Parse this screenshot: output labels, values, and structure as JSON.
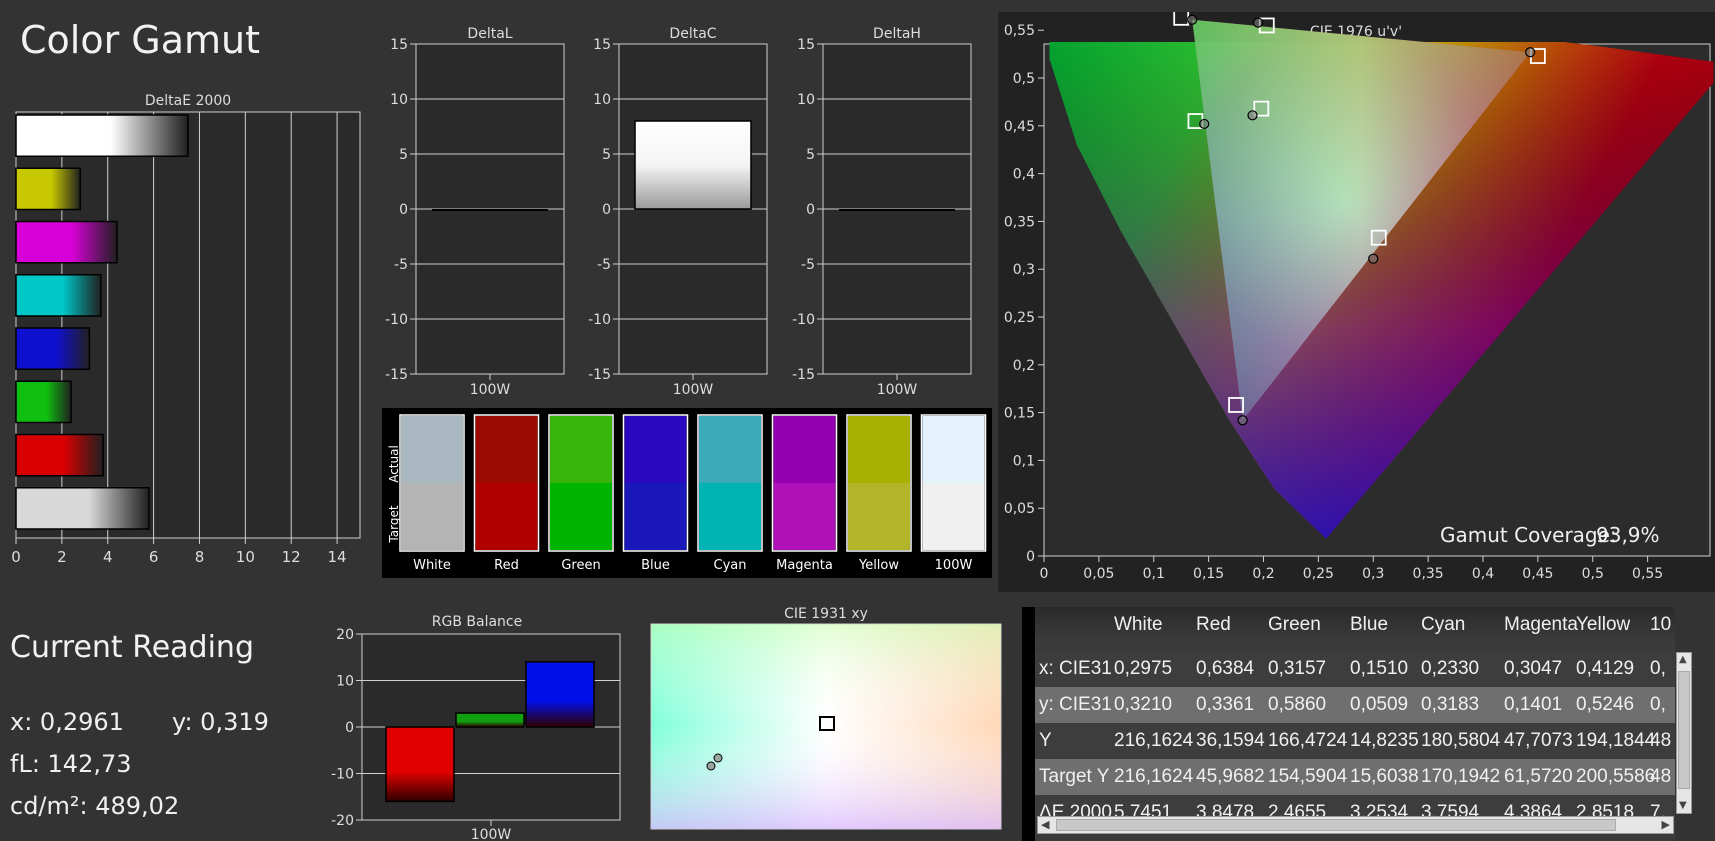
{
  "page": {
    "title": "Color Gamut"
  },
  "deltae": {
    "title": "DeltaE 2000",
    "x_ticks": [
      "0",
      "2",
      "4",
      "6",
      "8",
      "10",
      "12",
      "14"
    ],
    "bars": [
      {
        "value": 7.5,
        "color": "#ffffff"
      },
      {
        "value": 2.8,
        "color": "#c8c800"
      },
      {
        "value": 4.4,
        "color": "#d800d8"
      },
      {
        "value": 3.7,
        "color": "#00c8c8"
      },
      {
        "value": 3.2,
        "color": "#1010d0"
      },
      {
        "value": 2.4,
        "color": "#10c010"
      },
      {
        "value": 3.8,
        "color": "#d80000"
      },
      {
        "value": 5.8,
        "color": "#d8d8d8"
      }
    ]
  },
  "delta_panels": [
    {
      "title": "DeltaL",
      "value": 0,
      "xlabel": "100W"
    },
    {
      "title": "DeltaC",
      "value": 8,
      "xlabel": "100W"
    },
    {
      "title": "DeltaH",
      "value": 0,
      "xlabel": "100W"
    }
  ],
  "delta_y_ticks": [
    "15",
    "10",
    "5",
    "0",
    "-5",
    "-10",
    "-15"
  ],
  "swatches": {
    "actual_label": "Actual",
    "target_label": "Target",
    "items": [
      {
        "label": "White",
        "actual": "#a9b8c0",
        "target": "#b4b4b4"
      },
      {
        "label": "Red",
        "actual": "#9a0a00",
        "target": "#b00000"
      },
      {
        "label": "Green",
        "actual": "#38b40a",
        "target": "#00b400"
      },
      {
        "label": "Blue",
        "actual": "#2a08c0",
        "target": "#1a18b8"
      },
      {
        "label": "Cyan",
        "actual": "#3aaab8",
        "target": "#00b4b4"
      },
      {
        "label": "Magenta",
        "actual": "#9400b0",
        "target": "#b010b8"
      },
      {
        "label": "Yellow",
        "actual": "#a8b000",
        "target": "#b4b428"
      },
      {
        "label": "100W",
        "actual": "#e4f2fc",
        "target": "#f0f0f0"
      }
    ]
  },
  "cie1976": {
    "title": "CIE 1976 u'v'",
    "x_ticks": [
      "0",
      "0,05",
      "0,1",
      "0,15",
      "0,2",
      "0,25",
      "0,3",
      "0,35",
      "0,4",
      "0,45",
      "0,5",
      "0,55"
    ],
    "y_ticks": [
      "0",
      "0,05",
      "0,1",
      "0,15",
      "0,2",
      "0,25",
      "0,3",
      "0,35",
      "0,4",
      "0,45",
      "0,5",
      "0,55"
    ],
    "gamut_label": "Gamut Coverage:",
    "gamut_value": "93,9%",
    "targets": [
      [
        0.45,
        0.523
      ],
      [
        0.125,
        0.563
      ],
      [
        0.175,
        0.158
      ],
      [
        0.198,
        0.468
      ],
      [
        0.138,
        0.455
      ],
      [
        0.305,
        0.333
      ],
      [
        0.203,
        0.555
      ]
    ],
    "measured": [
      [
        0.443,
        0.527
      ],
      [
        0.135,
        0.561
      ],
      [
        0.181,
        0.142
      ],
      [
        0.19,
        0.461
      ],
      [
        0.146,
        0.452
      ],
      [
        0.3,
        0.311
      ],
      [
        0.195,
        0.558
      ]
    ]
  },
  "current": {
    "title": "Current Reading",
    "x": "x: 0,2961",
    "y": "y: 0,319",
    "fl": "fL: 142,73",
    "cdm2": "cd/m²: 489,02"
  },
  "rgb_balance": {
    "title": "RGB Balance",
    "xlabel": "100W",
    "y_ticks": [
      "20",
      "10",
      "0",
      "-10",
      "-20"
    ],
    "bars": [
      {
        "color": "#e00000",
        "value": -16
      },
      {
        "color": "#10a010",
        "value": 3
      },
      {
        "color": "#0010e8",
        "value": 14
      }
    ]
  },
  "cie1931": {
    "title": "CIE 1931 xy"
  },
  "table": {
    "headers": [
      "",
      "White",
      "Red",
      "Green",
      "Blue",
      "Cyan",
      "Magenta",
      "Yellow",
      "10"
    ],
    "rows": [
      [
        "x: CIE31",
        "0,2975",
        "0,6384",
        "0,3157",
        "0,1510",
        "0,2330",
        "0,3047",
        "0,4129",
        "0,"
      ],
      [
        "y: CIE31",
        "0,3210",
        "0,3361",
        "0,5860",
        "0,0509",
        "0,3183",
        "0,1401",
        "0,5246",
        "0,"
      ],
      [
        "Y",
        "216,1624",
        "36,1594",
        "166,4724",
        "14,8235",
        "180,5804",
        "47,7073",
        "194,1844",
        "48"
      ],
      [
        "Target Y",
        "216,1624",
        "45,9682",
        "154,5904",
        "15,6038",
        "170,1942",
        "61,5720",
        "200,5586",
        "48"
      ],
      [
        "ΔE 2000",
        "5,7451",
        "3,8478",
        "2,4655",
        "3,2534",
        "3,7594",
        "4,3864",
        "2,8518",
        "7,"
      ]
    ]
  }
}
